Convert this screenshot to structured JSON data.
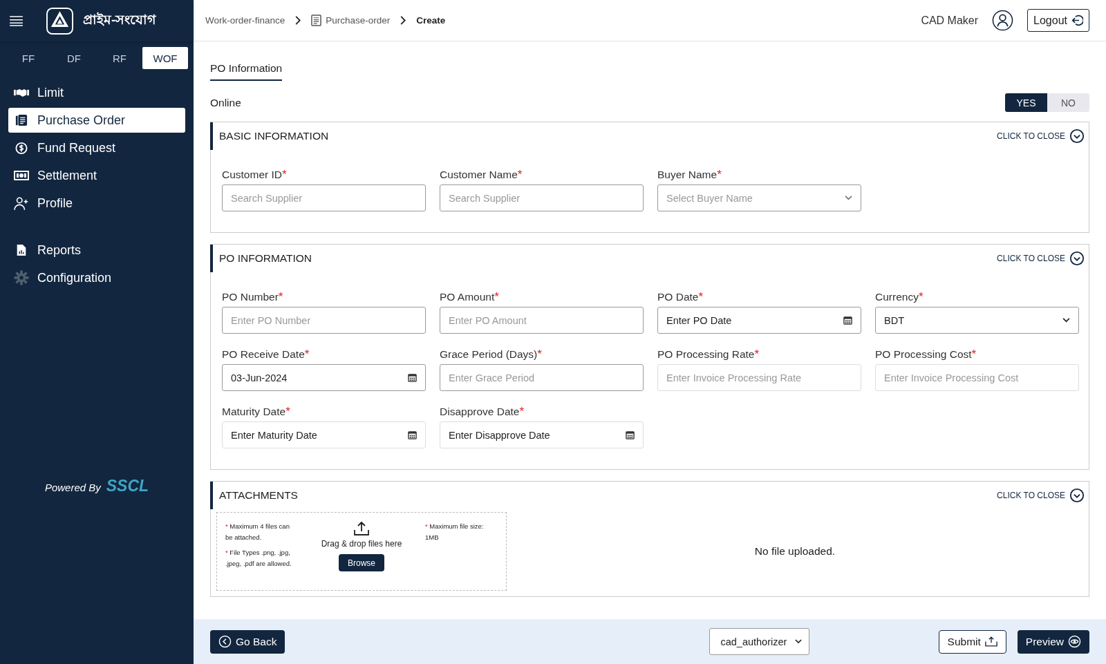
{
  "sidebar": {
    "logo_text": "প্রাইম-সংযোগ",
    "product_tabs": [
      {
        "label": "FF",
        "selected": false
      },
      {
        "label": "DF",
        "selected": false
      },
      {
        "label": "RF",
        "selected": false
      },
      {
        "label": "WOF",
        "selected": true
      }
    ],
    "items": [
      {
        "label": "Limit",
        "kind": "limit",
        "selected": false
      },
      {
        "label": "Purchase Order",
        "kind": "order",
        "selected": true
      },
      {
        "label": "Fund Request",
        "kind": "fund",
        "selected": false
      },
      {
        "label": "Settlement",
        "kind": "settlement",
        "selected": false
      },
      {
        "label": "Profile",
        "kind": "profile",
        "selected": false
      }
    ],
    "secondary_items": [
      {
        "label": "Reports",
        "kind": "reports",
        "selected": false
      },
      {
        "label": "Configuration",
        "kind": "config",
        "selected": false
      }
    ],
    "powered_by": "Powered By",
    "brand": "SSCL"
  },
  "breadcrumb": [
    {
      "label": "Work-order-finance",
      "current": false,
      "icon": false
    },
    {
      "label": "Purchase-order",
      "current": false,
      "icon": true
    },
    {
      "label": "Create",
      "current": true,
      "icon": false
    }
  ],
  "user": {
    "name": "CAD Maker",
    "logout": "Logout"
  },
  "page_tabs": [
    {
      "label": "PO Information",
      "selected": true
    }
  ],
  "online": {
    "label": "Online",
    "options": [
      {
        "label": "YES",
        "selected": true
      },
      {
        "label": "NO",
        "selected": false
      }
    ]
  },
  "sections": [
    {
      "title": "BASIC INFORMATION",
      "close_label": "CLICK TO CLOSE",
      "fields": [
        {
          "label": "Customer ID",
          "mark": "*",
          "kind": "text",
          "placeholder": "Search Supplier",
          "disabled": false
        },
        {
          "label": "Customer Name",
          "mark": "*",
          "kind": "text",
          "placeholder": "Search Supplier",
          "disabled": false
        },
        {
          "label": "Buyer Name",
          "mark": "*",
          "kind": "select",
          "placeholder": "Select Buyer Name",
          "disabled": false
        }
      ]
    },
    {
      "title": "PO INFORMATION",
      "close_label": "CLICK TO CLOSE",
      "fields": [
        {
          "label": "PO Number",
          "mark": "*",
          "kind": "text",
          "placeholder": "Enter PO Number",
          "disabled": false
        },
        {
          "label": "PO Amount",
          "mark": "*",
          "kind": "text",
          "placeholder": "Enter PO Amount",
          "disabled": false
        },
        {
          "label": "PO Date",
          "mark": "*",
          "kind": "date",
          "value": "Enter PO Date",
          "disabled": false
        },
        {
          "label": "Currency",
          "mark": "*",
          "kind": "select",
          "value": "BDT",
          "disabled": false
        },
        {
          "label": "PO Receive Date",
          "mark": "*",
          "kind": "date",
          "value": "03-Jun-2024",
          "disabled": false
        },
        {
          "label": "Grace Period (Days)",
          "mark": "*",
          "kind": "text",
          "placeholder": "Enter Grace Period",
          "disabled": false
        },
        {
          "label": "PO Processing Rate",
          "mark": "*",
          "kind": "text",
          "placeholder": "Enter Invoice Processing Rate",
          "disabled": true
        },
        {
          "label": "PO Processing Cost",
          "mark": "*",
          "kind": "text",
          "placeholder": "Enter Invoice Processing Cost",
          "disabled": true
        },
        {
          "label": "Maturity Date",
          "mark": "*",
          "kind": "date",
          "value": "Enter Maturity Date",
          "disabled": true
        },
        {
          "label": "Disapprove Date",
          "mark": "*",
          "kind": "date",
          "value": "Enter Disapprove Date",
          "disabled": true
        }
      ]
    }
  ],
  "attachments": {
    "title": "ATTACHMENTS",
    "close_label": "CLICK TO CLOSE",
    "left_notes": [
      {
        "mark": "*",
        "text": "Maximum 4 files can be attached."
      },
      {
        "mark": "*",
        "text": "File Types .png, .jpg, .jpeg, .pdf are allowed."
      }
    ],
    "drop_text": "Drag & drop files here",
    "browse": "Browse",
    "right_notes": [
      {
        "mark": "*",
        "text": "Maximum file size: 1MB"
      }
    ],
    "empty_text": "No file uploaded."
  },
  "footer": {
    "back": "Go Back",
    "role": "cad_authorizer",
    "submit": "Submit",
    "preview": "Preview"
  }
}
